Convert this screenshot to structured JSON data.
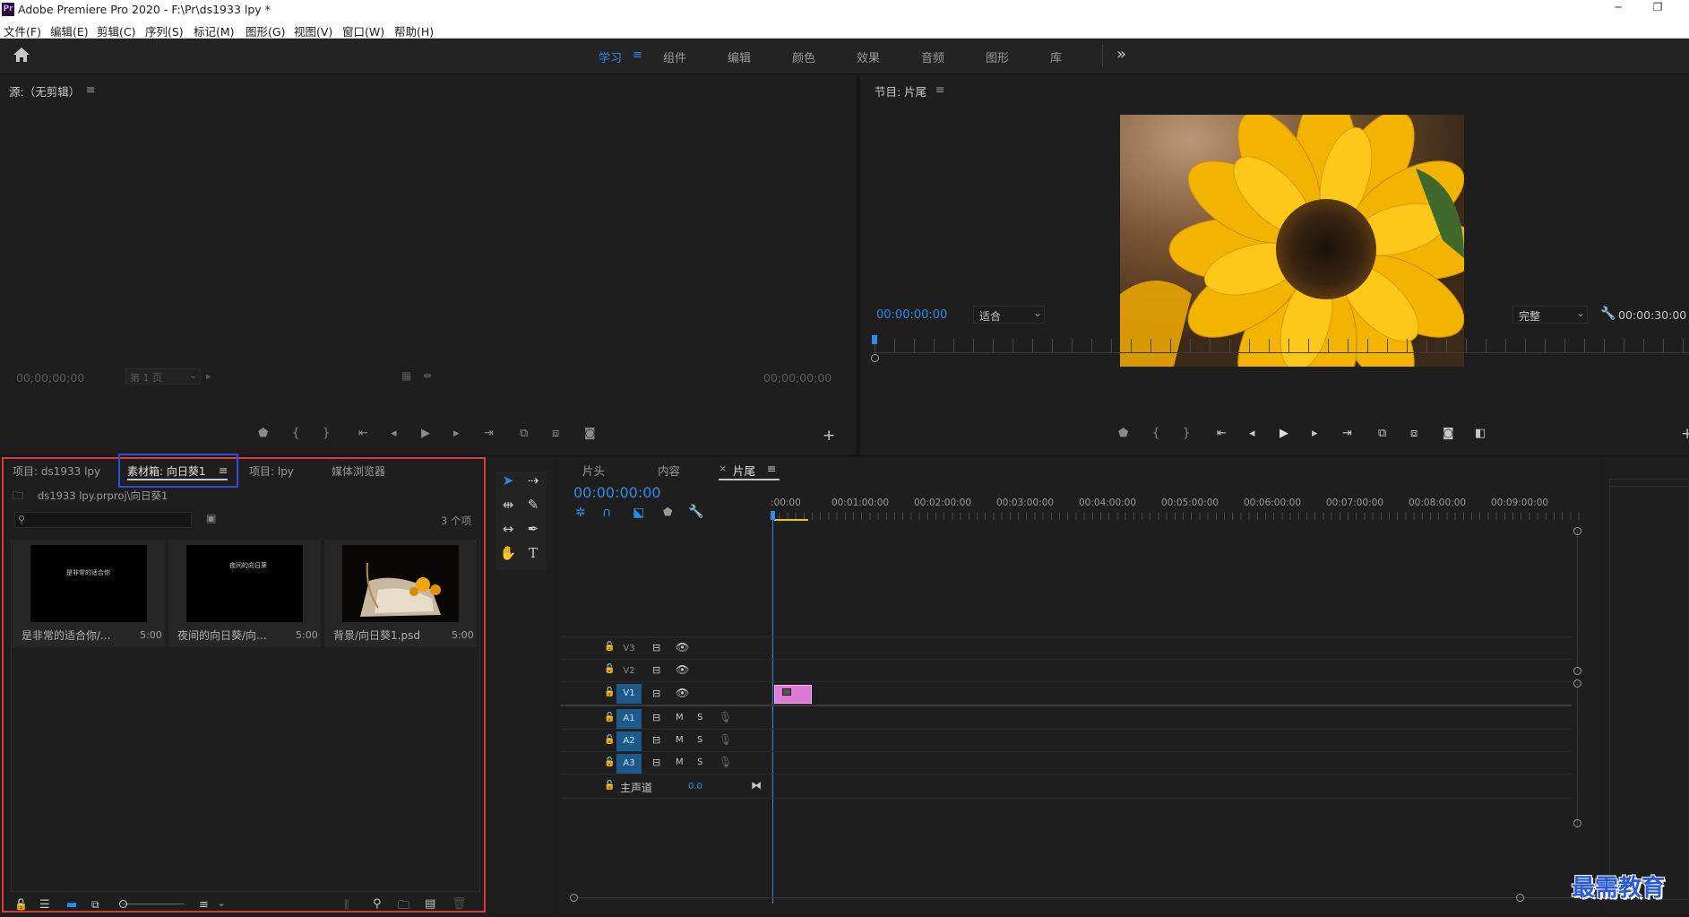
{
  "titlebar": {
    "app_icon": "Pr",
    "title": "Adobe Premiere Pro 2020 - F:\\Pr\\ds1933 lpy *",
    "minimize": "─",
    "restore": "❐"
  },
  "menubar": {
    "items": [
      "文件(F)",
      "编辑(E)",
      "剪辑(C)",
      "序列(S)",
      "标记(M)",
      "图形(G)",
      "视图(V)",
      "窗口(W)",
      "帮助(H)"
    ]
  },
  "workspace": {
    "tabs": [
      "学习",
      "组件",
      "编辑",
      "颜色",
      "效果",
      "音频",
      "图形",
      "库"
    ],
    "active": "学习",
    "more": "»"
  },
  "source_monitor": {
    "title": "源:（无剪辑）",
    "timecode_left": "00;00;00;00",
    "page_select": "第 1 页",
    "timecode_right": "00;00;00;00"
  },
  "program_monitor": {
    "title": "节目: 片尾",
    "timecode": "00:00:00:00",
    "fit_select": "适合",
    "quality_select": "完整",
    "duration": "00:00:30:00"
  },
  "project_panel": {
    "tabs": [
      "项目: ds1933 lpy",
      "素材箱: 向日葵1",
      "项目: lpy",
      "媒体浏览器"
    ],
    "active_tab": "素材箱: 向日葵1",
    "path": "ds1933 lpy.prproj\\向日葵1",
    "item_count": "3 个项",
    "items": [
      {
        "name": "是非常的适合你/...",
        "duration": "5:00",
        "thumb_text": "是非常的适合你"
      },
      {
        "name": "夜间的向日葵/向...",
        "duration": "5:00",
        "thumb_text": "夜间的向日葵"
      },
      {
        "name": "背景/向日葵1.psd",
        "duration": "5:00",
        "thumb_text": ""
      }
    ]
  },
  "timeline": {
    "tabs": [
      "片头",
      "内容",
      "片尾"
    ],
    "active_tab": "片尾",
    "timecode": "00:00:00:00",
    "ruler": [
      ":00:00",
      "00:01:00:00",
      "00:02:00:00",
      "00:03:00:00",
      "00:04:00:00",
      "00:05:00:00",
      "00:06:00:00",
      "00:07:00:00",
      "00:08:00:00",
      "00:09:00:00"
    ],
    "video_tracks": [
      "V3",
      "V2",
      "V1"
    ],
    "audio_tracks": [
      "A1",
      "A2",
      "A3"
    ],
    "mute": "M",
    "solo": "S",
    "master_label": "主声道",
    "master_value": "0.0"
  },
  "watermark": "最需教育",
  "colors": {
    "accent_blue": "#2d8ceb",
    "project_highlight": "#d93a3a",
    "tab_highlight": "#2f4fd6",
    "clip_pink": "#e07ad8",
    "track_badge": "#1d5a8c"
  }
}
